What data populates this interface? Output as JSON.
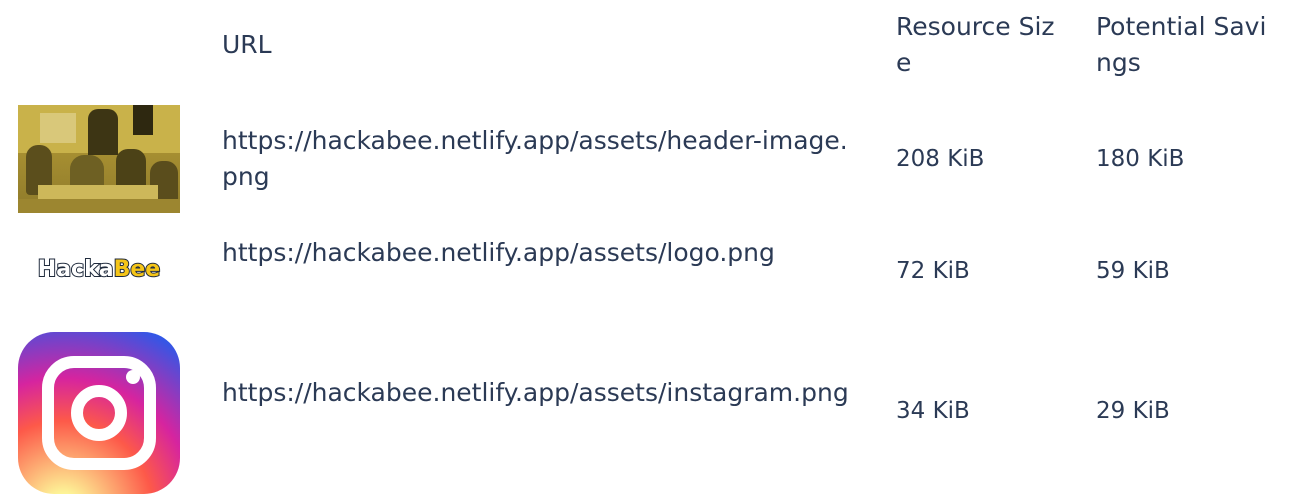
{
  "table": {
    "headers": {
      "url": "URL",
      "resource_size": "Resource Size",
      "potential_savings": "Potential Savings"
    },
    "rows": [
      {
        "thumbnail": "header-image-photo",
        "url": "https://hackabee.netlify.app/assets/header-image.png",
        "resource_size": "208 KiB",
        "potential_savings": "180 KiB"
      },
      {
        "thumbnail": "hackabee-logo",
        "logo_text": {
          "part1": "Hacka",
          "part2": "Bee"
        },
        "url": "https://hackabee.netlify.app/assets/logo.png",
        "resource_size": "72 KiB",
        "potential_savings": "59 KiB"
      },
      {
        "thumbnail": "instagram-icon",
        "url": "https://hackabee.netlify.app/assets/instagram.png",
        "resource_size": "34 KiB",
        "potential_savings": "29 KiB"
      }
    ]
  },
  "colors": {
    "text": "#2b3a55",
    "logo_accent": "#f5c518",
    "background": "#ffffff"
  }
}
